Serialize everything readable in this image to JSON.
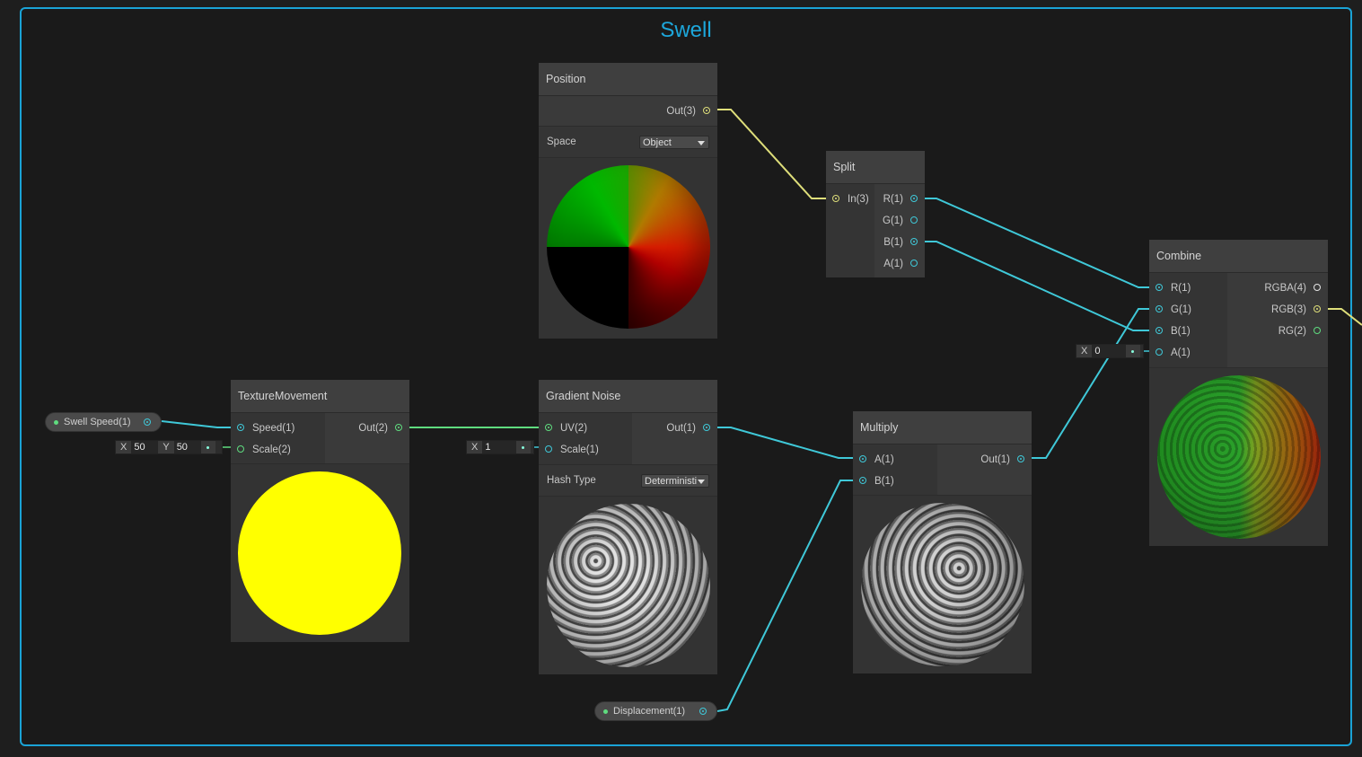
{
  "group": {
    "title": "Swell"
  },
  "colors": {
    "vector1": "#3fc8d8",
    "vector2": "#5fdc7f",
    "vector3": "#dede7a",
    "vector4": "#e6e6e6",
    "frame": "#1aa3d6"
  },
  "nodes": {
    "position": {
      "title": "Position",
      "out": "Out(3)",
      "space_label": "Space",
      "space_value": "Object"
    },
    "split": {
      "title": "Split",
      "in": "In(3)",
      "outs": [
        "R(1)",
        "G(1)",
        "B(1)",
        "A(1)"
      ]
    },
    "combine": {
      "title": "Combine",
      "ins": [
        "R(1)",
        "G(1)",
        "B(1)",
        "A(1)"
      ],
      "outs": [
        "RGBA(4)",
        "RGB(3)",
        "RG(2)"
      ],
      "a_field": {
        "label": "X",
        "value": "0"
      }
    },
    "texture_movement": {
      "title": "TextureMovement",
      "ins": [
        "Speed(1)",
        "Scale(2)"
      ],
      "out": "Out(2)",
      "scale_field": {
        "x_label": "X",
        "x_value": "50",
        "y_label": "Y",
        "y_value": "50"
      }
    },
    "gradient_noise": {
      "title": "Gradient Noise",
      "ins": [
        "UV(2)",
        "Scale(1)"
      ],
      "out": "Out(1)",
      "hash_label": "Hash Type",
      "hash_value": "Deterministi",
      "scale_field": {
        "label": "X",
        "value": "1"
      }
    },
    "multiply": {
      "title": "Multiply",
      "ins": [
        "A(1)",
        "B(1)"
      ],
      "out": "Out(1)"
    }
  },
  "properties": {
    "swell_speed": "Swell Speed(1)",
    "displacement": "Displacement(1)"
  }
}
